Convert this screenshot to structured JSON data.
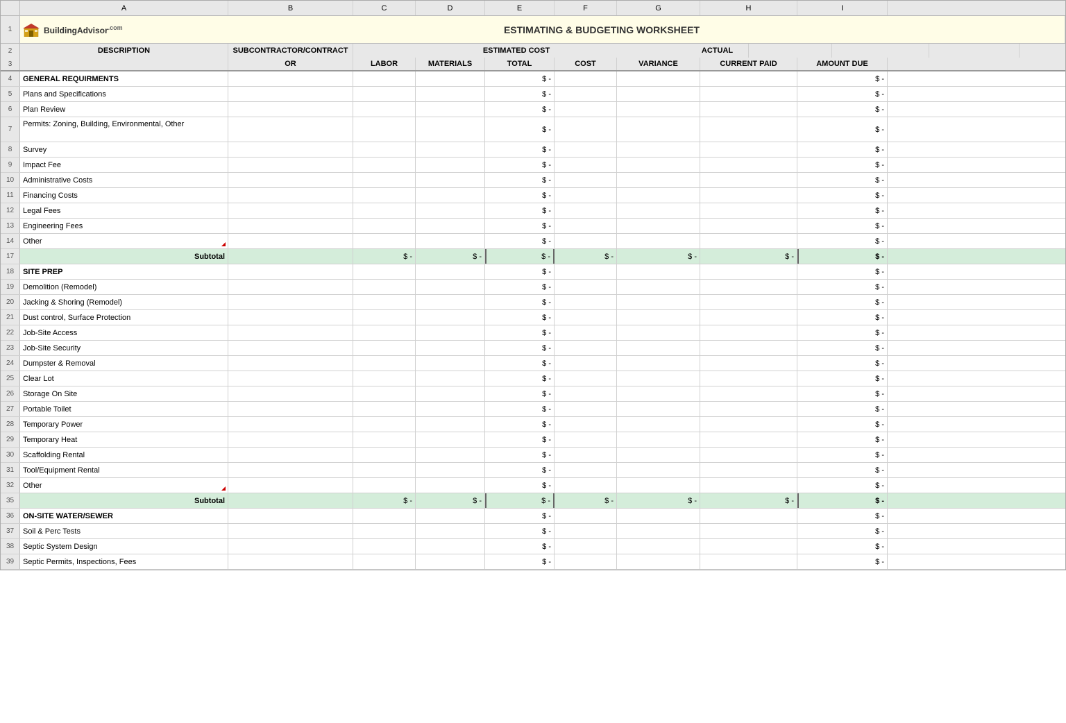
{
  "title": "ESTIMATING & BUDGETING WORKSHEET",
  "logo": {
    "name": "BuildingAdvisor",
    "suffix": ".com"
  },
  "columns": {
    "headers_row1": [
      "A",
      "B",
      "C",
      "D",
      "E",
      "F",
      "G",
      "H",
      "I"
    ],
    "col_a": "DESCRIPTION",
    "col_b": "SUBCONTRACTOR/CONTRACT OR",
    "col_c_label": "ESTIMATED COST",
    "col_c": "LABOR",
    "col_d": "MATERIALS",
    "col_e": "TOTAL",
    "col_f": "ACTUAL COST",
    "col_g": "VARIANCE",
    "col_h": "CURRENT PAID",
    "col_i": "AMOUNT DUE"
  },
  "rows": [
    {
      "num": "4",
      "type": "section",
      "desc": "GENERAL REQUIRMENTS",
      "hasTotal": true
    },
    {
      "num": "5",
      "type": "data",
      "desc": "Plans and Specifications",
      "hasTotal": true
    },
    {
      "num": "6",
      "type": "data",
      "desc": "Plan Review",
      "hasTotal": true
    },
    {
      "num": "7",
      "type": "data",
      "desc": "Permits: Zoning, Building, Environmental, Other",
      "hasTotal": true,
      "multiline": true
    },
    {
      "num": "8",
      "type": "data",
      "desc": "Survey",
      "hasTotal": true
    },
    {
      "num": "9",
      "type": "data",
      "desc": "Impact Fee",
      "hasTotal": true
    },
    {
      "num": "10",
      "type": "data",
      "desc": "Administrative Costs",
      "hasTotal": true
    },
    {
      "num": "11",
      "type": "data",
      "desc": "Financing Costs",
      "hasTotal": true
    },
    {
      "num": "12",
      "type": "data",
      "desc": "Legal Fees",
      "hasTotal": true
    },
    {
      "num": "13",
      "type": "data",
      "desc": "Engineering Fees",
      "hasTotal": true
    },
    {
      "num": "14",
      "type": "data",
      "desc": "Other",
      "hasTotal": true,
      "triangle": true
    },
    {
      "num": "17",
      "type": "subtotal",
      "desc": "Subtotal"
    },
    {
      "num": "18",
      "type": "section",
      "desc": "SITE PREP",
      "hasTotal": true
    },
    {
      "num": "19",
      "type": "data",
      "desc": "Demolition (Remodel)",
      "hasTotal": true
    },
    {
      "num": "20",
      "type": "data",
      "desc": "Jacking & Shoring (Remodel)",
      "hasTotal": true
    },
    {
      "num": "21",
      "type": "data",
      "desc": "Dust control, Surface Protection",
      "hasTotal": true
    },
    {
      "num": "22",
      "type": "data",
      "desc": "Job-Site Access",
      "hasTotal": true
    },
    {
      "num": "23",
      "type": "data",
      "desc": "Job-Site Security",
      "hasTotal": true
    },
    {
      "num": "24",
      "type": "data",
      "desc": "Dumpster & Removal",
      "hasTotal": true
    },
    {
      "num": "25",
      "type": "data",
      "desc": "Clear Lot",
      "hasTotal": true
    },
    {
      "num": "26",
      "type": "data",
      "desc": "Storage On Site",
      "hasTotal": true
    },
    {
      "num": "27",
      "type": "data",
      "desc": "Portable Toilet",
      "hasTotal": true
    },
    {
      "num": "28",
      "type": "data",
      "desc": "Temporary Power",
      "hasTotal": true
    },
    {
      "num": "29",
      "type": "data",
      "desc": "Temporary Heat",
      "hasTotal": true
    },
    {
      "num": "30",
      "type": "data",
      "desc": "Scaffolding Rental",
      "hasTotal": true
    },
    {
      "num": "31",
      "type": "data",
      "desc": "Tool/Equipment Rental",
      "hasTotal": true
    },
    {
      "num": "32",
      "type": "data",
      "desc": "Other",
      "hasTotal": true,
      "triangle": true
    },
    {
      "num": "35",
      "type": "subtotal",
      "desc": "Subtotal"
    },
    {
      "num": "36",
      "type": "section",
      "desc": "ON-SITE WATER/SEWER",
      "hasTotal": true
    },
    {
      "num": "37",
      "type": "data",
      "desc": "Soil & Perc Tests",
      "hasTotal": true
    },
    {
      "num": "38",
      "type": "data",
      "desc": "Septic System Design",
      "hasTotal": true
    },
    {
      "num": "39",
      "type": "data",
      "desc": "Septic Permits, Inspections, Fees",
      "hasTotal": true
    }
  ]
}
